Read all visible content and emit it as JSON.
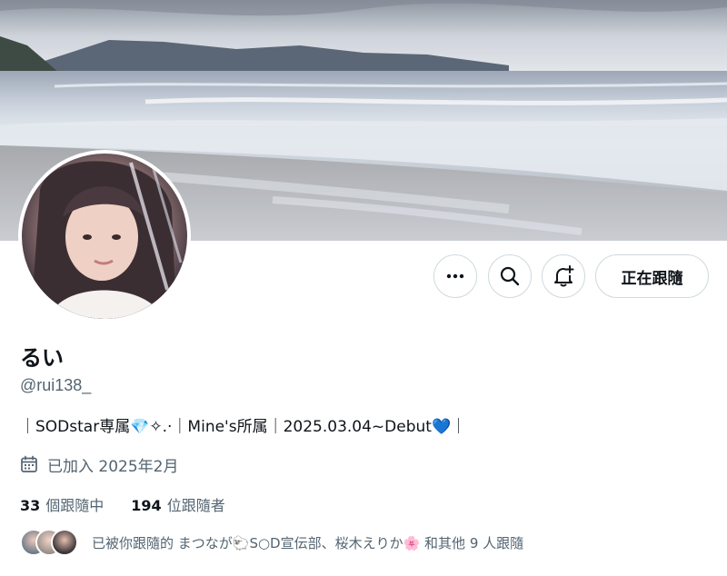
{
  "profile": {
    "display_name": "るい",
    "handle": "@rui138_",
    "bio_part1": "｜SODstar専属",
    "bio_gem": "💎",
    "bio_part2": "✧.·｜Mine's所属｜2025.03.04~Debut",
    "bio_heart": "💙",
    "bio_part3": "｜",
    "joined": "已加入 2025年2月"
  },
  "actions": {
    "more_icon": "more-dots-icon",
    "search_icon": "search-icon",
    "notify_icon": "bell-plus-icon",
    "follow_label": "正在跟隨"
  },
  "stats": {
    "following_count": "33",
    "following_label": "個跟隨中",
    "followers_count": "194",
    "followers_label": "位跟隨者"
  },
  "followed_by": {
    "text": "已被你跟隨的 まつなが🐑S○D宣伝部、桜木えりか🌸 和其他 9 人跟隨"
  },
  "colors": {
    "secondary_text": "#536471",
    "primary_text": "#0f1419",
    "border": "#cfd9de"
  }
}
